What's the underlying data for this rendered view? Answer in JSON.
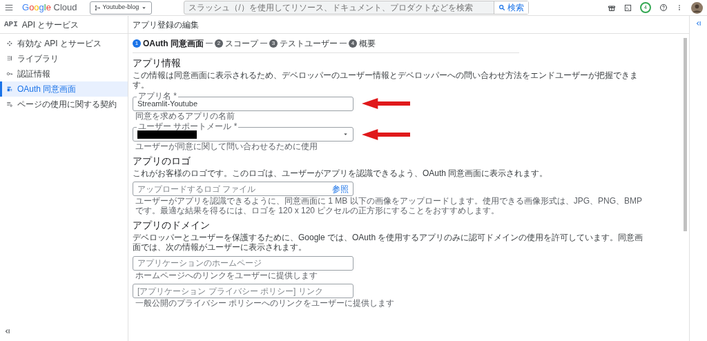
{
  "topbar": {
    "logo": "Google Cloud",
    "project": "Youtube-blog",
    "search": {
      "placeholder": "スラッシュ（/）を使用してリソース、ドキュメント、プロダクトなどを検索",
      "button": "検索"
    },
    "notification_count": "4"
  },
  "sidebar": {
    "badge": "API",
    "title": "API とサービス",
    "items": [
      {
        "label": "有効な API とサービス",
        "selected": false
      },
      {
        "label": "ライブラリ",
        "selected": false
      },
      {
        "label": "認証情報",
        "selected": false
      },
      {
        "label": "OAuth 同意画面",
        "selected": true
      },
      {
        "label": "ページの使用に関する契約",
        "selected": false
      }
    ]
  },
  "page_title": "アプリ登録の編集",
  "steps": [
    {
      "number": "1",
      "label": "OAuth 同意画面",
      "selected": true
    },
    {
      "number": "2",
      "label": "スコープ",
      "selected": false
    },
    {
      "number": "3",
      "label": "テストユーザー",
      "selected": false
    },
    {
      "number": "4",
      "label": "概要",
      "selected": false
    }
  ],
  "sections": [
    {
      "heading": "アプリ情報",
      "text": "この情報は同意画面に表示されるため、デベロッパーのユーザー情報とデベロッパーへの問い合わせ方法をエンドユーザーが把握できます。",
      "fields": [
        {
          "kind": "text",
          "label": "アプリ名 *",
          "value": "Streamlit-Youtube",
          "helper": "同意を求めるアプリの名前",
          "arrow": true
        },
        {
          "kind": "select",
          "label": "ユーザー サポートメール *",
          "redacted": true,
          "helper": "ユーザーが同意に関して問い合わせるために使用",
          "arrow": true
        }
      ]
    },
    {
      "heading": "アプリのロゴ",
      "text": "これがお客様のロゴです。このロゴは、ユーザーがアプリを認識できるよう、OAuth 同意画面に表示されます。",
      "fields": [
        {
          "kind": "file",
          "placeholder": "アップロードするロゴ ファイル",
          "button": "参照",
          "helper": "ユーザーがアプリを認識できるように、同意画面に 1 MB 以下の画像をアップロードします。使用できる画像形式は、JPG、PNG、BMP です。最適な結果を得るには、ロゴを 120 x 120 ピクセルの正方形にすることをおすすめします。"
        }
      ]
    },
    {
      "heading": "アプリのドメイン",
      "text": "デベロッパーとユーザーを保護するために、Google では、OAuth を使用するアプリのみに認可ドメインの使用を許可しています。同意画面では、次の情報がユーザーに表示されます。",
      "fields": [
        {
          "kind": "text",
          "placeholder": "アプリケーションのホームページ",
          "helper": "ホームページへのリンクをユーザーに提供します"
        },
        {
          "kind": "text",
          "placeholder": "[アプリケーション プライバシー ポリシー] リンク",
          "helper": "一般公開のプライバシー ポリシーへのリンクをユーザーに提供します"
        }
      ]
    }
  ]
}
